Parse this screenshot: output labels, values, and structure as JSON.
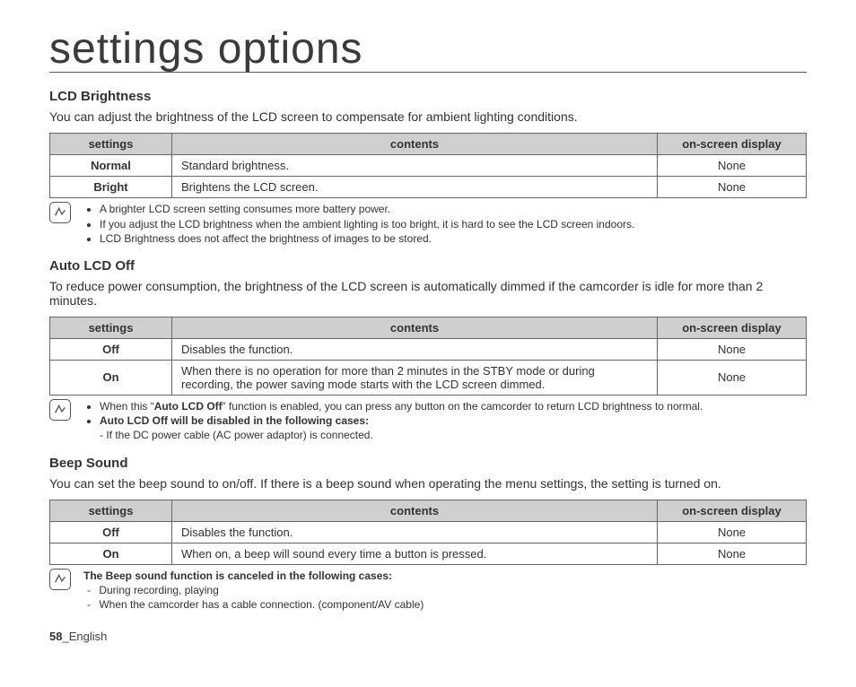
{
  "page_title": "settings options",
  "sections": [
    {
      "heading": "LCD Brightness",
      "desc": "You can adjust the brightness of the LCD screen to compensate for ambient lighting conditions.",
      "columns": {
        "c1": "settings",
        "c2": "contents",
        "c3": "on-screen display"
      },
      "rows": [
        {
          "setting": "Normal",
          "contents": "Standard brightness.",
          "display": "None"
        },
        {
          "setting": "Bright",
          "contents": "Brightens the LCD screen.",
          "display": "None"
        }
      ],
      "notes": {
        "bullets": [
          "A brighter LCD screen setting consumes more battery power.",
          "If you adjust the LCD brightness when the ambient lighting is too bright, it is hard to see the LCD screen indoors.",
          "LCD Brightness does not affect the brightness of images to be stored."
        ]
      }
    },
    {
      "heading": "Auto LCD Off",
      "desc": "To reduce power consumption, the brightness of the LCD screen is automatically dimmed if the camcorder is idle for more than 2 minutes.",
      "columns": {
        "c1": "settings",
        "c2": "contents",
        "c3": "on-screen display"
      },
      "rows": [
        {
          "setting": "Off",
          "contents": "Disables the function.",
          "display": "None"
        },
        {
          "setting": "On",
          "contents": "When there is no operation for more than 2 minutes in the STBY mode or during recording, the power saving mode starts with the LCD screen dimmed.",
          "display": "None"
        }
      ],
      "notes": {
        "b1_pre": "When this “",
        "b1_bold": "Auto LCD Off",
        "b1_post": "” function is enabled, you can press any button on the camcorder to return LCD brightness to normal.",
        "b2_bold": "Auto LCD Off will be disabled in the following cases:",
        "b2_sub": "- If the DC power cable (AC power adaptor) is connected."
      }
    },
    {
      "heading": "Beep Sound",
      "desc": "You can set the beep sound to on/off. If there is a beep sound when operating the menu settings, the setting is turned on.",
      "columns": {
        "c1": "settings",
        "c2": "contents",
        "c3": "on-screen display"
      },
      "rows": [
        {
          "setting": "Off",
          "contents": "Disables the function.",
          "display": "None"
        },
        {
          "setting": "On",
          "contents": "When on, a beep will sound every time a button is pressed.",
          "display": "None"
        }
      ],
      "notes": {
        "heading": "The Beep sound function is canceled in the following cases:",
        "dashes": [
          "During recording, playing",
          "When the camcorder has a cable connection. (component/AV cable)"
        ]
      }
    }
  ],
  "footer": {
    "page": "58",
    "lang": "_English"
  }
}
